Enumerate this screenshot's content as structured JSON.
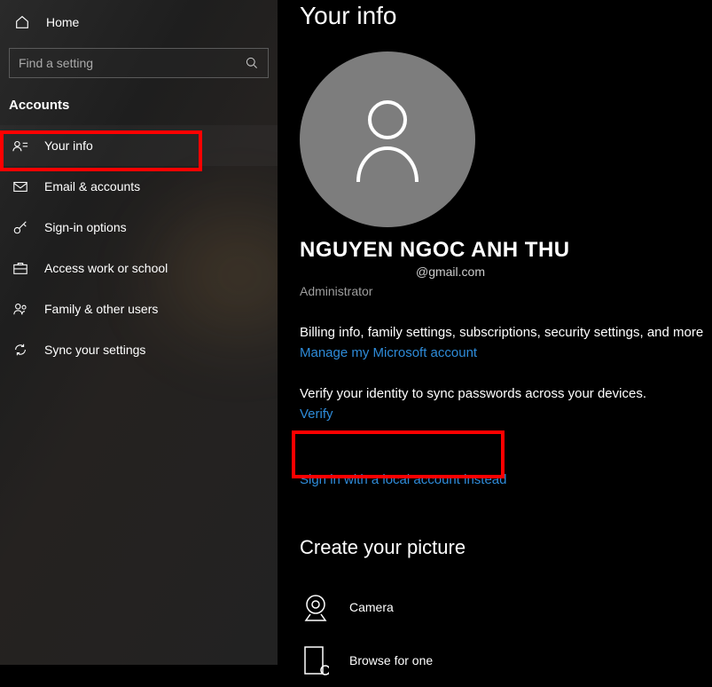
{
  "sidebar": {
    "home_label": "Home",
    "search_placeholder": "Find a setting",
    "section_title": "Accounts",
    "items": [
      {
        "label": "Your info"
      },
      {
        "label": "Email & accounts"
      },
      {
        "label": "Sign-in options"
      },
      {
        "label": "Access work or school"
      },
      {
        "label": "Family & other users"
      },
      {
        "label": "Sync your settings"
      }
    ]
  },
  "main": {
    "page_title": "Your info",
    "user_name": "NGUYEN NGOC ANH THU",
    "user_email": "@gmail.com",
    "user_role": "Administrator",
    "billing_desc": "Billing info, family settings, subscriptions, security settings, and more",
    "manage_link": "Manage my Microsoft account",
    "verify_desc": "Verify your identity to sync passwords across your devices.",
    "verify_link": "Verify",
    "local_account_link": "Sign in with a local account instead",
    "picture_section": "Create your picture",
    "camera_label": "Camera",
    "browse_label": "Browse for one"
  }
}
